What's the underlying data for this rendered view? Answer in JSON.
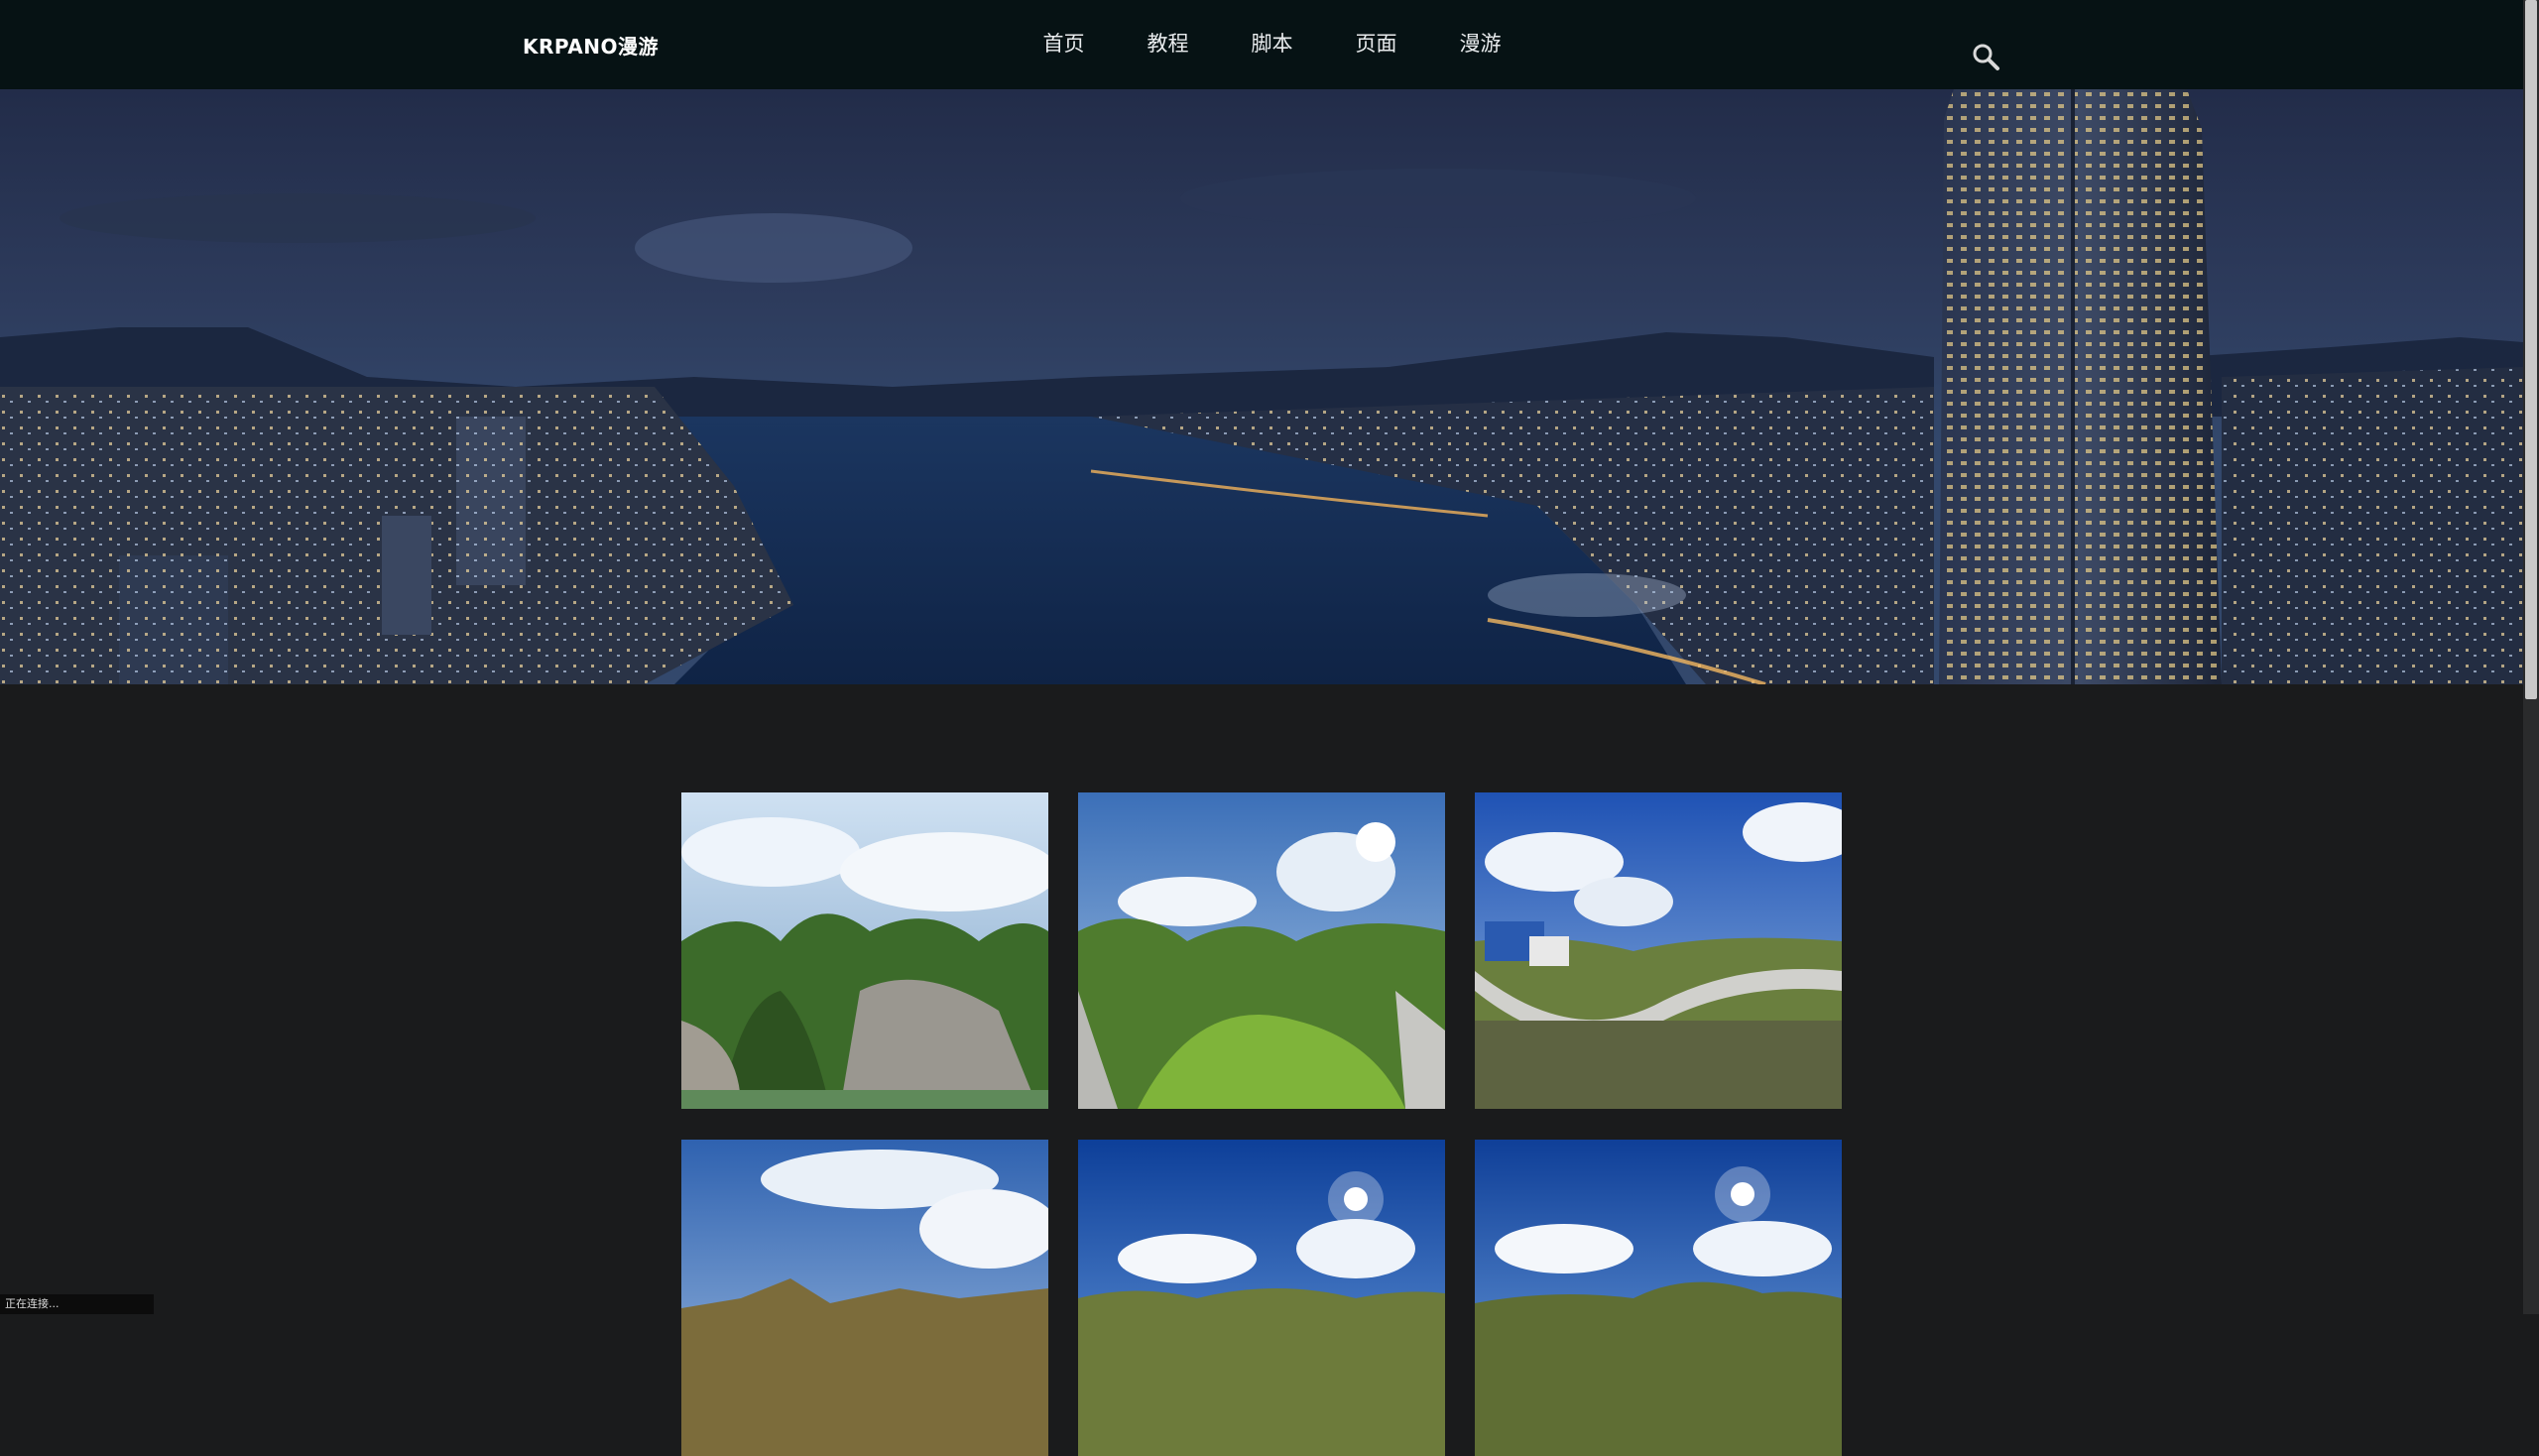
{
  "header": {
    "logo": "KRPANO漫游",
    "nav": [
      "首页",
      "教程",
      "脚本",
      "页面",
      "漫游"
    ],
    "search_icon": "search-icon"
  },
  "hero": {
    "description_icon": "city-night-banner"
  },
  "gallery": {
    "items": [
      {
        "icon": "panorama-mountain-town"
      },
      {
        "icon": "panorama-green-valley"
      },
      {
        "icon": "panorama-mountain-road"
      },
      {
        "icon": "panorama-cloudy-peaks"
      },
      {
        "icon": "panorama-sun-clouds"
      },
      {
        "icon": "panorama-sun-ridge"
      }
    ]
  },
  "status": {
    "text": "正在连接..."
  },
  "colors": {
    "topbar": "#061214",
    "page_bg": "#1a1b1c",
    "nav_text": "#e9ecee"
  }
}
